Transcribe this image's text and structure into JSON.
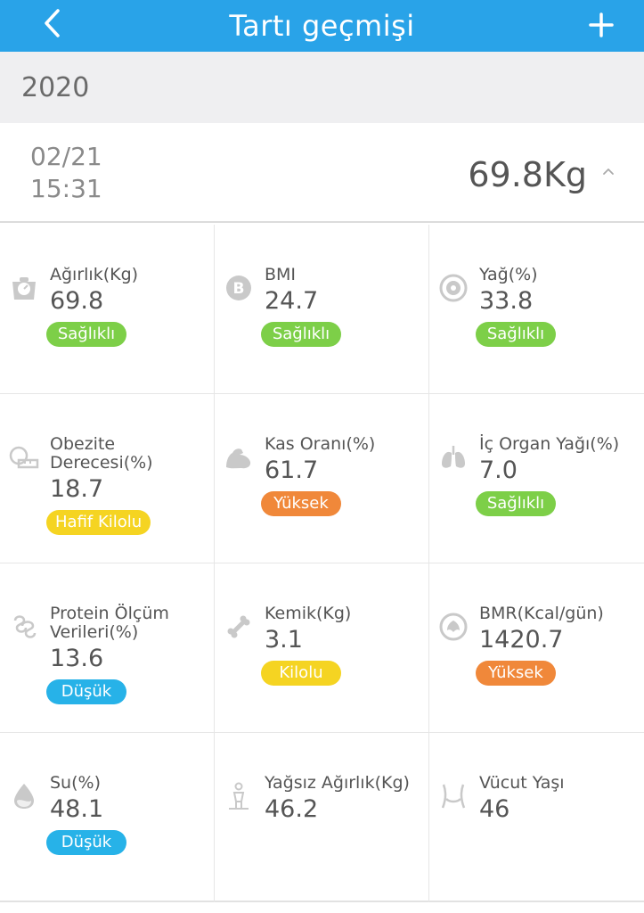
{
  "header": {
    "title": "Tartı geçmişi",
    "accent_color": "#29a3e8",
    "back_icon": "chevron-left-icon",
    "add_icon": "plus-icon"
  },
  "year": "2020",
  "record": {
    "date": "02/21",
    "time": "15:31",
    "weight": "69.8Kg",
    "chevron_icon": "chevron-up-icon"
  },
  "metrics": [
    {
      "label": "Ağırlık(Kg)",
      "value": "69.8",
      "status": "Sağlıklı",
      "status_color": "#7dcf48",
      "icon": "scale-icon"
    },
    {
      "label": "BMI",
      "value": "24.7",
      "status": "Sağlıklı",
      "status_color": "#7dcf48",
      "icon": "bmi-icon"
    },
    {
      "label": "Yağ(%)",
      "value": "33.8",
      "status": "Sağlıklı",
      "status_color": "#7dcf48",
      "icon": "fat-icon"
    },
    {
      "label": "Obezite Derecesi(%)",
      "value": "18.7",
      "status": "Hafif Kilolu",
      "status_color": "#f5d422",
      "icon": "tape-measure-icon"
    },
    {
      "label": "Kas Oranı(%)",
      "value": "61.7",
      "status": "Yüksek",
      "status_color": "#f0883a",
      "icon": "muscle-icon"
    },
    {
      "label": "İç Organ Yağı(%)",
      "value": "7.0",
      "status": "Sağlıklı",
      "status_color": "#7dcf48",
      "icon": "lungs-icon"
    },
    {
      "label": "Protein Ölçüm Verileri(%)",
      "value": "13.6",
      "status": "Düşük",
      "status_color": "#27b2e8",
      "icon": "protein-icon"
    },
    {
      "label": "Kemik(Kg)",
      "value": "3.1",
      "status": "Kilolu",
      "status_color": "#f5d422",
      "icon": "bone-icon"
    },
    {
      "label": "BMR(Kcal/gün)",
      "value": "1420.7",
      "status": "Yüksek",
      "status_color": "#f0883a",
      "icon": "metabolism-icon"
    },
    {
      "label": "Su(%)",
      "value": "48.1",
      "status": "Düşük",
      "status_color": "#27b2e8",
      "icon": "water-drop-icon"
    },
    {
      "label": "Yağsız Ağırlık(Kg)",
      "value": "46.2",
      "status": "",
      "status_color": "",
      "icon": "body-figure-icon"
    },
    {
      "label": "Vücut Yaşı",
      "value": "46",
      "status": "",
      "status_color": "",
      "icon": "waist-icon"
    }
  ]
}
